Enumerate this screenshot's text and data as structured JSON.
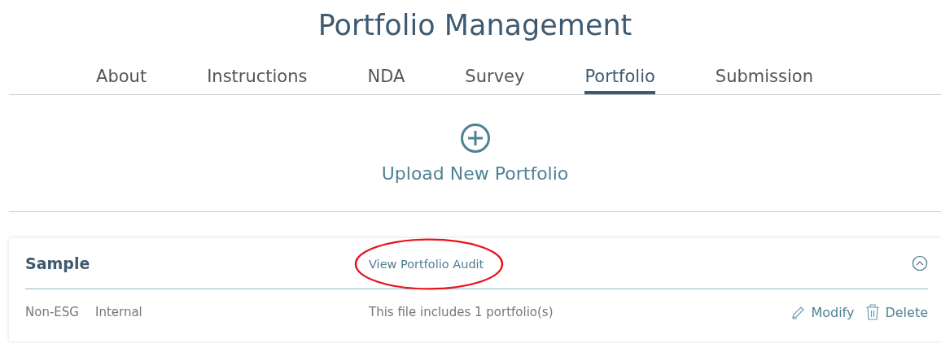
{
  "page_title": "Portfolio Management",
  "tabs": [
    {
      "label": "About",
      "selected": false
    },
    {
      "label": "Instructions",
      "selected": false
    },
    {
      "label": "NDA",
      "selected": false
    },
    {
      "label": "Survey",
      "selected": false
    },
    {
      "label": "Portfolio",
      "selected": true
    },
    {
      "label": "Submission",
      "selected": false
    }
  ],
  "upload": {
    "label": "Upload New Portfolio"
  },
  "portfolios": [
    {
      "name": "Sample",
      "audit_link": "View Portfolio Audit",
      "audit_link_highlighted": true,
      "expanded": true,
      "tags": [
        "Non-ESG",
        "Internal"
      ],
      "summary": "This file includes 1 portfolio(s)",
      "actions": [
        {
          "kind": "modify",
          "label": "Modify"
        },
        {
          "kind": "delete",
          "label": "Delete"
        }
      ]
    }
  ]
}
